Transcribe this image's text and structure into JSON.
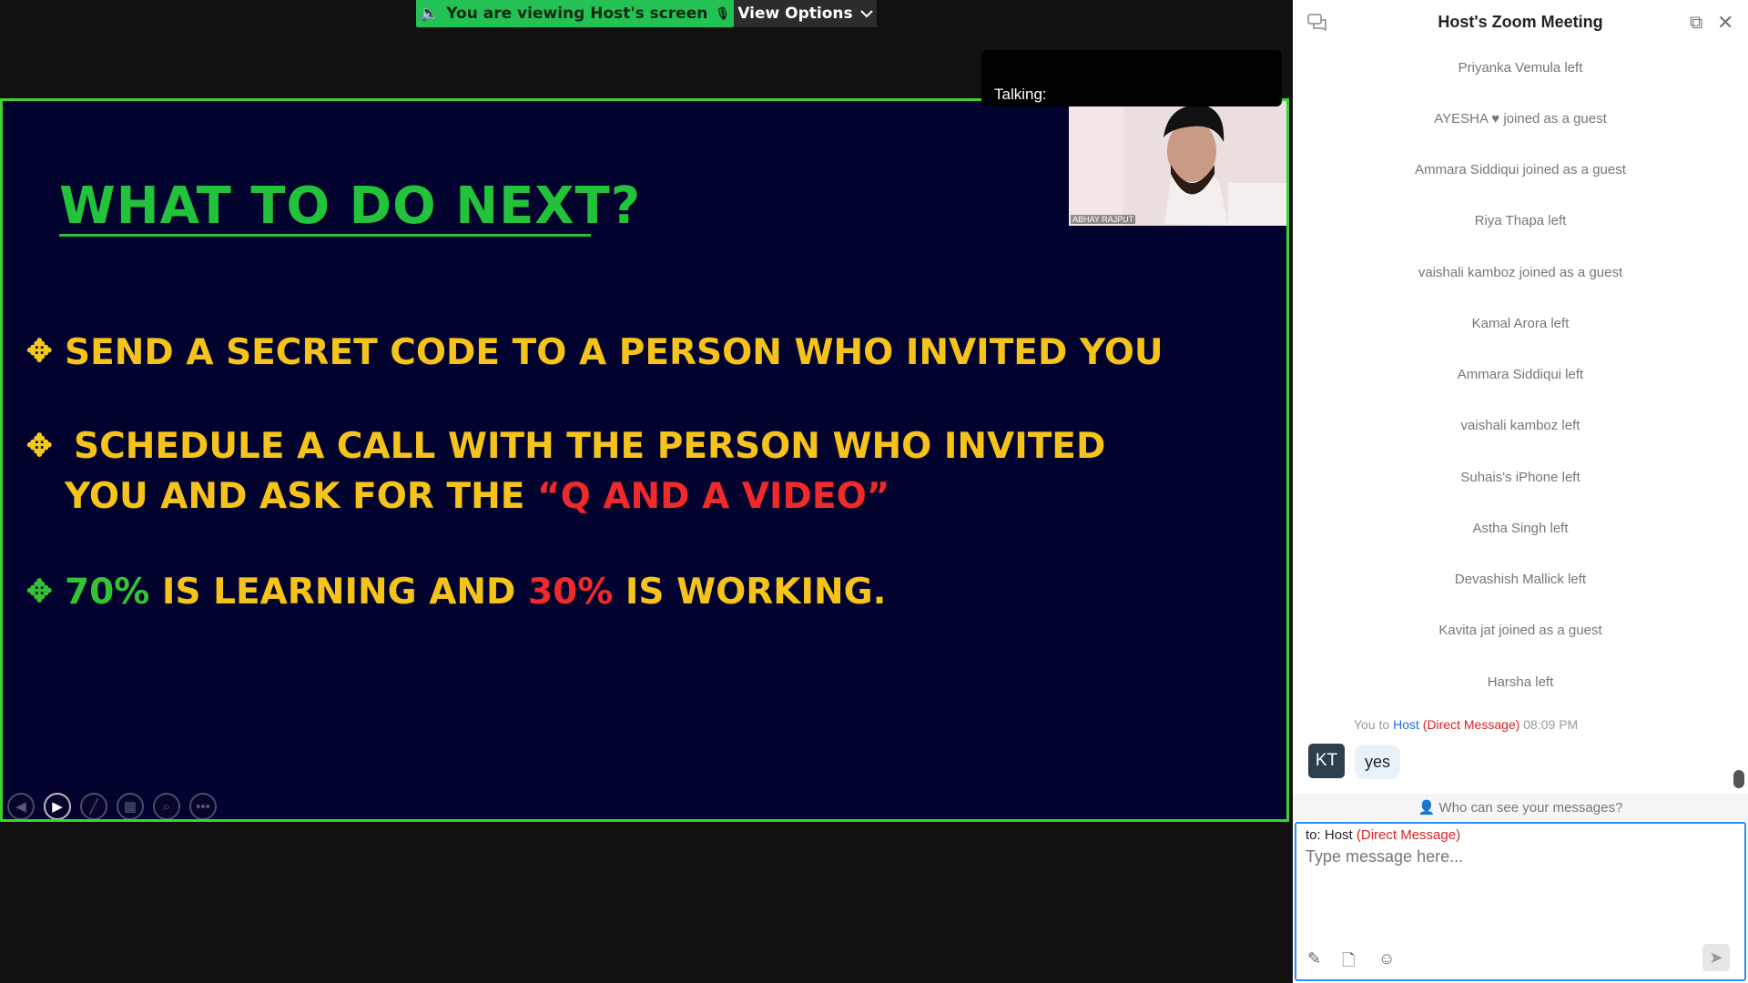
{
  "banner": {
    "viewing_text": "You are viewing Host's screen",
    "view_options_label": "View Options"
  },
  "talking": {
    "label": "Talking:"
  },
  "slide": {
    "title": "WHAT TO DO NEXT?",
    "bullet1": "SEND A SECRET CODE TO A PERSON WHO INVITED YOU",
    "bullet2_line1": "SCHEDULE A CALL WITH THE PERSON WHO INVITED",
    "bullet2_line2_prefix": "YOU AND ASK FOR THE ",
    "bullet2_line2_quote": "“Q AND A VIDEO”",
    "bullet3_part1": "70%",
    "bullet3_part2": " IS LEARNING AND ",
    "bullet3_part3": "30%",
    "bullet3_part4": " IS WORKING.",
    "video_name": "ABHAY RAJPUT",
    "colors": {
      "background": "#02022e",
      "yellow": "#f5c31a",
      "green": "#22c23b",
      "red": "#f02a2a"
    }
  },
  "chat": {
    "title": "Host's Zoom Meeting",
    "messages": [
      "Priyanka Vemula left",
      "AYESHA ♥ joined as a guest",
      "Ammara Siddiqui joined as a guest",
      "Riya Thapa left",
      "vaishali kamboz joined as a guest",
      "Kamal Arora left",
      "Ammara Siddiqui left",
      "vaishali kamboz left",
      "Suhais's iPhone left",
      "Astha Singh left",
      "Devashish Mallick left",
      "Kavita jat joined as a guest",
      "Harsha left"
    ],
    "dm": {
      "you": "You",
      "to": "to",
      "host": "Host",
      "tag": "(Direct Message)",
      "time": "08:09 PM",
      "avatar_initials": "KT",
      "text": "yes"
    },
    "privacy_text": "Who can see your messages?",
    "compose": {
      "to_label": "to:",
      "to_name": "Host",
      "to_tag": "(Direct Message)",
      "placeholder": "Type message here..."
    }
  }
}
